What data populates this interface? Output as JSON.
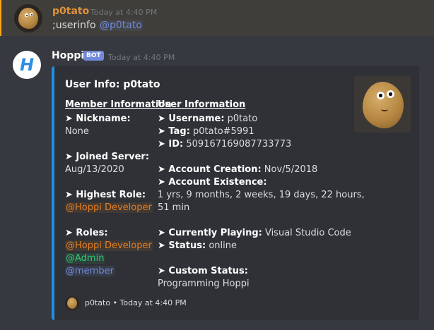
{
  "message1": {
    "author": "p0tato",
    "timestamp": "Today at 4:40 PM",
    "command": ";userinfo ",
    "mention": "@p0tato",
    "author_color": "#e0923a"
  },
  "message2": {
    "author": "Hoppi",
    "bot_tag": "BOT",
    "timestamp": "Today at 4:40 PM",
    "avatar_letter": "H"
  },
  "embed": {
    "title": "User Info: p0tato",
    "left_header": "Member Information",
    "right_header": "User Information",
    "nickname_label": "➤ Nickname:",
    "nickname": "None",
    "joined_label": "➤ Joined Server:",
    "joined": "Aug/13/2020",
    "highest_role_label": "➤ Highest Role:",
    "highest_role": "@Hoppi Developer",
    "roles_label": "➤ Roles:",
    "roles": [
      "@Hoppi Developer",
      "@Admin",
      "@member"
    ],
    "username_label": "➤ Username:",
    "username": " p0tato",
    "tag_label": "➤ Tag:",
    "tag": " p0tato#5991",
    "id_label": "➤ ID:",
    "id": " 509167169087733773",
    "creation_label": "➤ Account Creation:",
    "creation": " Nov/5/2018",
    "existence_label": "➤ Account Existence:",
    "existence_line1": "1 yrs, 9 months, 2 weeks, 19 days, 22 hours,",
    "existence_line2": "51 min",
    "playing_label": "➤ Currently Playing:",
    "playing": " Visual Studio Code",
    "status_label": "➤ Status:",
    "status": " online",
    "custom_status_label": "➤ Custom Status:",
    "custom_status": "Programming Hoppi",
    "footer_text": "p0tato • Today at 4:40 PM",
    "accent_color": "#1e90e8"
  }
}
